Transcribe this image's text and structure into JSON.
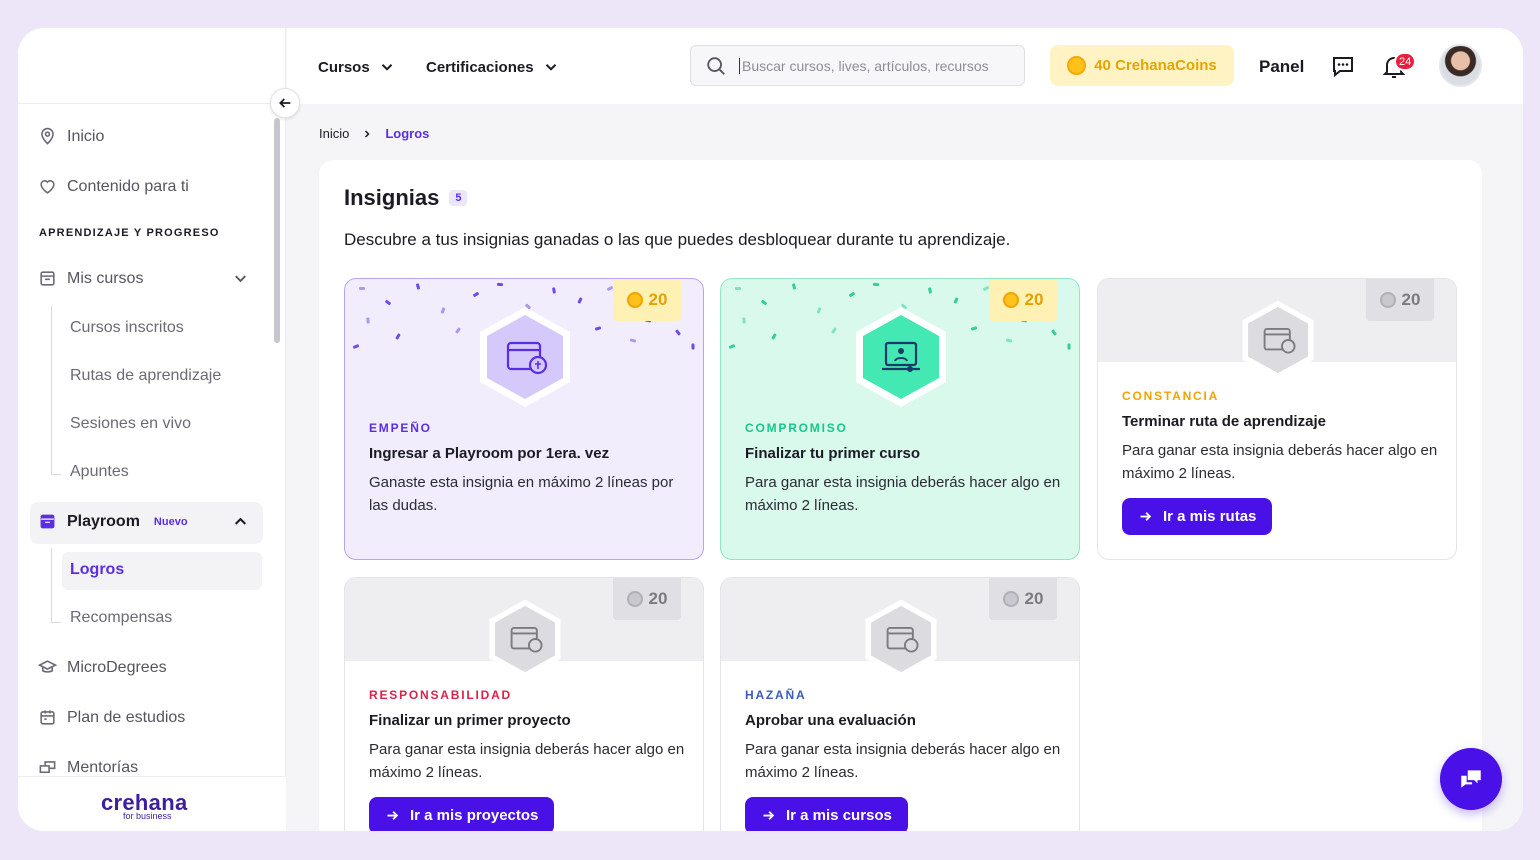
{
  "nav": {
    "courses": "Cursos",
    "certifications": "Certificaciones"
  },
  "search": {
    "placeholder": "Buscar cursos, lives, artículos, recursos"
  },
  "coins": {
    "label": "40 CrehanaCoins"
  },
  "header": {
    "panel": "Panel",
    "notifications_count": "24"
  },
  "sidebar": {
    "home": "Inicio",
    "for_you": "Contenido para ti",
    "section": "APRENDIZAJE Y PROGRESO",
    "my_courses": "Mis cursos",
    "my_courses_sub": [
      "Cursos inscritos",
      "Rutas de aprendizaje",
      "Sesiones en vivo",
      "Apuntes"
    ],
    "playroom": "Playroom",
    "playroom_tag": "Nuevo",
    "playroom_sub": [
      "Logros",
      "Recompensas"
    ],
    "microdegrees": "MicroDegrees",
    "study_plan": "Plan de estudios",
    "mentoring": "Mentorías",
    "logo": "crehana",
    "logo_sub": "for business"
  },
  "breadcrumb": {
    "home": "Inicio",
    "current": "Logros"
  },
  "main": {
    "title": "Insignias",
    "count": "5",
    "description": "Descubre a tus insignias ganadas o las que puedes desbloquear durante tu aprendizaje."
  },
  "badges": [
    {
      "points": "20",
      "category": "EMPEÑO",
      "title": "Ingresar a Playroom por 1era. vez",
      "text": "Ganaste esta insignia en máximo 2 líneas por las dudas.",
      "state": "earned",
      "color": "#5a2ee6"
    },
    {
      "points": "20",
      "category": "COMPROMISO",
      "title": "Finalizar tu primer curso",
      "text": "Para ganar esta insignia deberás hacer algo en máximo 2 líneas.",
      "state": "earned",
      "color": "#14c98a"
    },
    {
      "points": "20",
      "category": "CONSTANCIA",
      "title": "Terminar ruta de aprendizaje",
      "text": "Para ganar esta insignia deberás hacer algo en máximo 2 líneas.",
      "state": "locked",
      "color": "#f0a400",
      "cta": "Ir a mis rutas"
    },
    {
      "points": "20",
      "category": "RESPONSABILIDAD",
      "title": "Finalizar un primer proyecto",
      "text": "Para ganar esta insignia deberás hacer algo en máximo 2 líneas.",
      "state": "locked",
      "color": "#d8234a",
      "cta": "Ir a mis proyectos"
    },
    {
      "points": "20",
      "category": "HAZAÑA",
      "title": "Aprobar una evaluación",
      "text": "Para ganar esta insignia deberás hacer algo en máximo 2 líneas.",
      "state": "locked",
      "color": "#3a5cb8",
      "cta": "Ir a mis cursos"
    }
  ]
}
